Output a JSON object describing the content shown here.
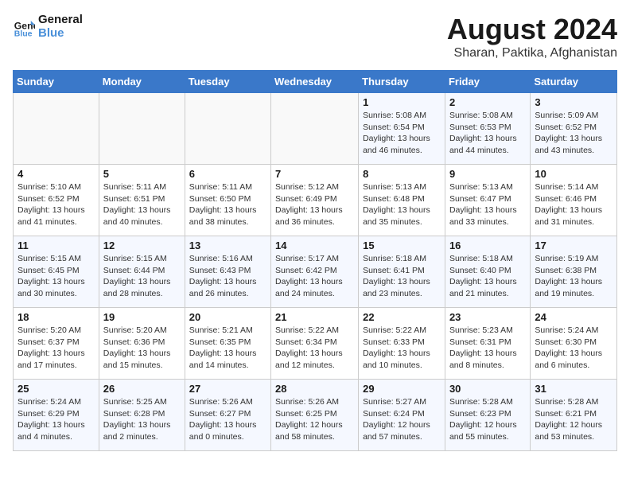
{
  "logo": {
    "line1": "General",
    "line2": "Blue"
  },
  "title": "August 2024",
  "subtitle": "Sharan, Paktika, Afghanistan",
  "days_of_week": [
    "Sunday",
    "Monday",
    "Tuesday",
    "Wednesday",
    "Thursday",
    "Friday",
    "Saturday"
  ],
  "weeks": [
    [
      {
        "day": "",
        "info": ""
      },
      {
        "day": "",
        "info": ""
      },
      {
        "day": "",
        "info": ""
      },
      {
        "day": "",
        "info": ""
      },
      {
        "day": "1",
        "info": "Sunrise: 5:08 AM\nSunset: 6:54 PM\nDaylight: 13 hours\nand 46 minutes."
      },
      {
        "day": "2",
        "info": "Sunrise: 5:08 AM\nSunset: 6:53 PM\nDaylight: 13 hours\nand 44 minutes."
      },
      {
        "day": "3",
        "info": "Sunrise: 5:09 AM\nSunset: 6:52 PM\nDaylight: 13 hours\nand 43 minutes."
      }
    ],
    [
      {
        "day": "4",
        "info": "Sunrise: 5:10 AM\nSunset: 6:52 PM\nDaylight: 13 hours\nand 41 minutes."
      },
      {
        "day": "5",
        "info": "Sunrise: 5:11 AM\nSunset: 6:51 PM\nDaylight: 13 hours\nand 40 minutes."
      },
      {
        "day": "6",
        "info": "Sunrise: 5:11 AM\nSunset: 6:50 PM\nDaylight: 13 hours\nand 38 minutes."
      },
      {
        "day": "7",
        "info": "Sunrise: 5:12 AM\nSunset: 6:49 PM\nDaylight: 13 hours\nand 36 minutes."
      },
      {
        "day": "8",
        "info": "Sunrise: 5:13 AM\nSunset: 6:48 PM\nDaylight: 13 hours\nand 35 minutes."
      },
      {
        "day": "9",
        "info": "Sunrise: 5:13 AM\nSunset: 6:47 PM\nDaylight: 13 hours\nand 33 minutes."
      },
      {
        "day": "10",
        "info": "Sunrise: 5:14 AM\nSunset: 6:46 PM\nDaylight: 13 hours\nand 31 minutes."
      }
    ],
    [
      {
        "day": "11",
        "info": "Sunrise: 5:15 AM\nSunset: 6:45 PM\nDaylight: 13 hours\nand 30 minutes."
      },
      {
        "day": "12",
        "info": "Sunrise: 5:15 AM\nSunset: 6:44 PM\nDaylight: 13 hours\nand 28 minutes."
      },
      {
        "day": "13",
        "info": "Sunrise: 5:16 AM\nSunset: 6:43 PM\nDaylight: 13 hours\nand 26 minutes."
      },
      {
        "day": "14",
        "info": "Sunrise: 5:17 AM\nSunset: 6:42 PM\nDaylight: 13 hours\nand 24 minutes."
      },
      {
        "day": "15",
        "info": "Sunrise: 5:18 AM\nSunset: 6:41 PM\nDaylight: 13 hours\nand 23 minutes."
      },
      {
        "day": "16",
        "info": "Sunrise: 5:18 AM\nSunset: 6:40 PM\nDaylight: 13 hours\nand 21 minutes."
      },
      {
        "day": "17",
        "info": "Sunrise: 5:19 AM\nSunset: 6:38 PM\nDaylight: 13 hours\nand 19 minutes."
      }
    ],
    [
      {
        "day": "18",
        "info": "Sunrise: 5:20 AM\nSunset: 6:37 PM\nDaylight: 13 hours\nand 17 minutes."
      },
      {
        "day": "19",
        "info": "Sunrise: 5:20 AM\nSunset: 6:36 PM\nDaylight: 13 hours\nand 15 minutes."
      },
      {
        "day": "20",
        "info": "Sunrise: 5:21 AM\nSunset: 6:35 PM\nDaylight: 13 hours\nand 14 minutes."
      },
      {
        "day": "21",
        "info": "Sunrise: 5:22 AM\nSunset: 6:34 PM\nDaylight: 13 hours\nand 12 minutes."
      },
      {
        "day": "22",
        "info": "Sunrise: 5:22 AM\nSunset: 6:33 PM\nDaylight: 13 hours\nand 10 minutes."
      },
      {
        "day": "23",
        "info": "Sunrise: 5:23 AM\nSunset: 6:31 PM\nDaylight: 13 hours\nand 8 minutes."
      },
      {
        "day": "24",
        "info": "Sunrise: 5:24 AM\nSunset: 6:30 PM\nDaylight: 13 hours\nand 6 minutes."
      }
    ],
    [
      {
        "day": "25",
        "info": "Sunrise: 5:24 AM\nSunset: 6:29 PM\nDaylight: 13 hours\nand 4 minutes."
      },
      {
        "day": "26",
        "info": "Sunrise: 5:25 AM\nSunset: 6:28 PM\nDaylight: 13 hours\nand 2 minutes."
      },
      {
        "day": "27",
        "info": "Sunrise: 5:26 AM\nSunset: 6:27 PM\nDaylight: 13 hours\nand 0 minutes."
      },
      {
        "day": "28",
        "info": "Sunrise: 5:26 AM\nSunset: 6:25 PM\nDaylight: 12 hours\nand 58 minutes."
      },
      {
        "day": "29",
        "info": "Sunrise: 5:27 AM\nSunset: 6:24 PM\nDaylight: 12 hours\nand 57 minutes."
      },
      {
        "day": "30",
        "info": "Sunrise: 5:28 AM\nSunset: 6:23 PM\nDaylight: 12 hours\nand 55 minutes."
      },
      {
        "day": "31",
        "info": "Sunrise: 5:28 AM\nSunset: 6:21 PM\nDaylight: 12 hours\nand 53 minutes."
      }
    ]
  ]
}
